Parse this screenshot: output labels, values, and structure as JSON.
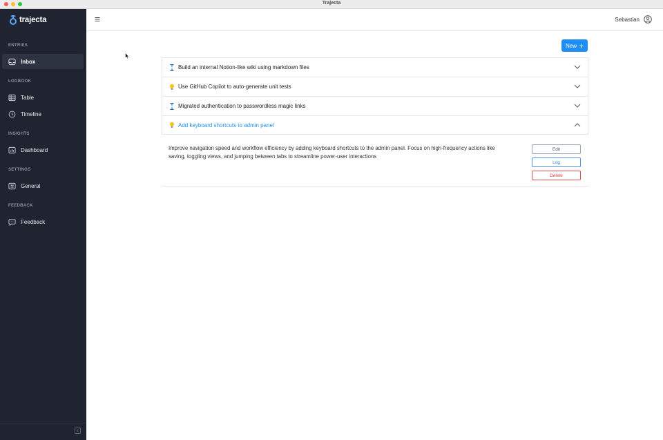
{
  "window": {
    "title": "Trajecta"
  },
  "brand": {
    "name": "trajecta",
    "accent": "#1f8ff5"
  },
  "sidebar": {
    "sections": [
      {
        "label": "ENTRIES",
        "items": [
          {
            "label": "Inbox",
            "icon": "inbox-icon",
            "active": true
          }
        ]
      },
      {
        "label": "LOGBOOK",
        "items": [
          {
            "label": "Table",
            "icon": "table-icon"
          },
          {
            "label": "Timeline",
            "icon": "clock-icon"
          }
        ]
      },
      {
        "label": "INSIGHTS",
        "items": [
          {
            "label": "Dashboard",
            "icon": "dashboard-icon"
          }
        ]
      },
      {
        "label": "SETTINGS",
        "items": [
          {
            "label": "General",
            "icon": "settings-icon"
          }
        ]
      },
      {
        "label": "FEEDBACK",
        "items": [
          {
            "label": "Feedback",
            "icon": "feedback-icon"
          }
        ]
      }
    ]
  },
  "header": {
    "user": "Sebastian"
  },
  "toolbar": {
    "new_label": "New"
  },
  "entries": [
    {
      "title": "Build an internal Notion-like wiki using markdown files",
      "icon": "hourglass-icon",
      "expanded": false
    },
    {
      "title": "Use GitHub Copilot to auto-generate unit tests",
      "icon": "lightbulb-icon",
      "expanded": false
    },
    {
      "title": "Migrated authentication to passwordless magic links",
      "icon": "hourglass-icon",
      "expanded": false
    },
    {
      "title": "Add keyboard shortcuts to admin panel",
      "icon": "lightbulb-icon",
      "expanded": true
    }
  ],
  "detail": {
    "description": "Improve navigation speed and workflow efficiency by adding keyboard shortcuts to the admin panel. Focus on high-frequency actions like saving, toggling views, and jumping between tabs to streamline power-user interactions",
    "edit_label": "Edit",
    "log_label": "Log",
    "delete_label": "Delete"
  }
}
